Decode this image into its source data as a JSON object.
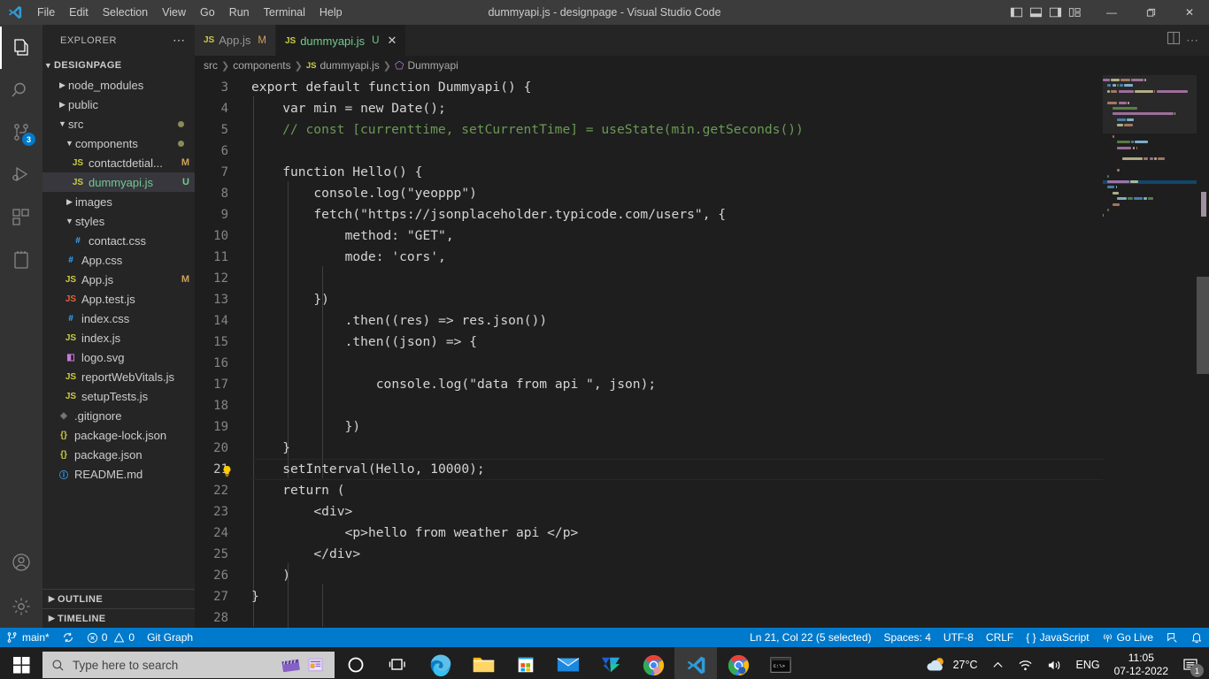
{
  "titlebar": {
    "logo_icon": "vscode-logo-icon",
    "menu": [
      "File",
      "Edit",
      "Selection",
      "View",
      "Go",
      "Run",
      "Terminal",
      "Help"
    ],
    "window_title": "dummyapi.js - designpage - Visual Studio Code",
    "layout_icons": [
      "toggle-primary-sidebar-icon",
      "toggle-panel-icon",
      "toggle-secondary-sidebar-icon",
      "customize-layout-icon"
    ],
    "controls": {
      "minimize": "—",
      "maximize": "❐",
      "close": "✕"
    }
  },
  "activitybar": {
    "items": [
      {
        "name": "explorer",
        "icon": "files-icon",
        "active": true,
        "badge": ""
      },
      {
        "name": "search",
        "icon": "search-icon",
        "active": false,
        "badge": ""
      },
      {
        "name": "source-control",
        "icon": "source-control-icon",
        "active": false,
        "badge": "3"
      },
      {
        "name": "run-and-debug",
        "icon": "run-debug-icon",
        "active": false,
        "badge": ""
      },
      {
        "name": "extensions",
        "icon": "extensions-icon",
        "active": false,
        "badge": ""
      },
      {
        "name": "todo-notes",
        "icon": "notebook-icon",
        "active": false,
        "badge": ""
      }
    ],
    "bottom": [
      {
        "name": "accounts",
        "icon": "account-icon"
      },
      {
        "name": "manage-settings",
        "icon": "gear-icon"
      }
    ]
  },
  "sidebar": {
    "title": "EXPLORER",
    "more_actions": "⋯",
    "root": {
      "label": "DESIGNPAGE",
      "expanded": true
    },
    "tree": [
      {
        "label": "node_modules",
        "type": "folder",
        "depth": 1,
        "expanded": false,
        "icon": "chevron-right-icon",
        "badge": "",
        "dirty": false
      },
      {
        "label": "public",
        "type": "folder",
        "depth": 1,
        "expanded": false,
        "icon": "chevron-right-icon",
        "badge": "",
        "dirty": false
      },
      {
        "label": "src",
        "type": "folder",
        "depth": 1,
        "expanded": true,
        "icon": "chevron-down-icon",
        "badge": "",
        "dirty": true
      },
      {
        "label": "components",
        "type": "folder",
        "depth": 2,
        "expanded": true,
        "icon": "chevron-down-icon",
        "badge": "",
        "dirty": true
      },
      {
        "label": "contactdetial...",
        "type": "js",
        "depth": 3,
        "badge": "M",
        "badge_color": "#cfa25c",
        "selected": false
      },
      {
        "label": "dummyapi.js",
        "type": "js",
        "depth": 3,
        "badge": "U",
        "badge_color": "#73c991",
        "selected": true,
        "text_color": "#73c991"
      },
      {
        "label": "images",
        "type": "folder",
        "depth": 2,
        "expanded": false,
        "icon": "chevron-right-icon",
        "badge": "",
        "dirty": false
      },
      {
        "label": "styles",
        "type": "folder",
        "depth": 2,
        "expanded": true,
        "icon": "chevron-down-icon",
        "badge": "",
        "dirty": false
      },
      {
        "label": "contact.css",
        "type": "css",
        "depth": 3,
        "badge": "",
        "selected": false
      },
      {
        "label": "App.css",
        "type": "css",
        "depth": 2,
        "badge": "",
        "selected": false
      },
      {
        "label": "App.js",
        "type": "js",
        "depth": 2,
        "badge": "M",
        "badge_color": "#cfa25c",
        "selected": false
      },
      {
        "label": "App.test.js",
        "type": "jstest",
        "depth": 2,
        "badge": "",
        "selected": false
      },
      {
        "label": "index.css",
        "type": "css",
        "depth": 2,
        "badge": "",
        "selected": false
      },
      {
        "label": "index.js",
        "type": "js",
        "depth": 2,
        "badge": "",
        "selected": false
      },
      {
        "label": "logo.svg",
        "type": "svg",
        "depth": 2,
        "badge": "",
        "selected": false
      },
      {
        "label": "reportWebVitals.js",
        "type": "js",
        "depth": 2,
        "badge": "",
        "selected": false
      },
      {
        "label": "setupTests.js",
        "type": "js",
        "depth": 2,
        "badge": "",
        "selected": false
      },
      {
        "label": ".gitignore",
        "type": "git",
        "depth": 1,
        "badge": "",
        "selected": false
      },
      {
        "label": "package-lock.json",
        "type": "json",
        "depth": 1,
        "badge": "",
        "selected": false
      },
      {
        "label": "package.json",
        "type": "json",
        "depth": 1,
        "badge": "",
        "selected": false
      },
      {
        "label": "README.md",
        "type": "md",
        "depth": 1,
        "badge": "",
        "selected": false
      }
    ],
    "sections": [
      {
        "label": "OUTLINE",
        "expanded": false,
        "icon": "chevron-right-icon"
      },
      {
        "label": "TIMELINE",
        "expanded": false,
        "icon": "chevron-right-icon"
      }
    ]
  },
  "editor": {
    "tabs": [
      {
        "label": "App.js",
        "icon": "js-file-icon",
        "status": "M",
        "status_type": "modified",
        "active": false,
        "closable": false
      },
      {
        "label": "dummyapi.js",
        "icon": "js-file-icon",
        "status": "U",
        "status_type": "untracked",
        "active": true,
        "closable": true
      }
    ],
    "tab_actions": [
      {
        "name": "split-editor-icon",
        "label": "split-editor"
      },
      {
        "name": "more-actions-icon",
        "label": "⋯"
      }
    ],
    "breadcrumbs": [
      "src",
      "components",
      "dummyapi.js",
      "Dummyapi"
    ],
    "breadcrumb_symbol_icon": "class-symbol-icon",
    "first_visible_line": 3,
    "last_visible_line": 28,
    "current_line": 21,
    "lightbulb_line": 21,
    "lines": [
      {
        "n": 3,
        "text": "export default function Dummyapi() {"
      },
      {
        "n": 4,
        "text": "    var min = new Date();"
      },
      {
        "n": 5,
        "text": "    // const [currenttime, setCurrentTime] = useState(min.getSeconds())"
      },
      {
        "n": 6,
        "text": ""
      },
      {
        "n": 7,
        "text": "    function Hello() {"
      },
      {
        "n": 8,
        "text": "        console.log(\"yeoppp\")"
      },
      {
        "n": 9,
        "text": "        fetch(\"https://jsonplaceholder.typicode.com/users\", {"
      },
      {
        "n": 10,
        "text": "            method: \"GET\","
      },
      {
        "n": 11,
        "text": "            mode: 'cors',"
      },
      {
        "n": 12,
        "text": ""
      },
      {
        "n": 13,
        "text": "        })"
      },
      {
        "n": 14,
        "text": "            .then((res) => res.json())"
      },
      {
        "n": 15,
        "text": "            .then((json) => {"
      },
      {
        "n": 16,
        "text": ""
      },
      {
        "n": 17,
        "text": "                console.log(\"data from api \", json);"
      },
      {
        "n": 18,
        "text": ""
      },
      {
        "n": 19,
        "text": "            })"
      },
      {
        "n": 20,
        "text": "    }"
      },
      {
        "n": 21,
        "text": "    setInterval(Hello, 10000);"
      },
      {
        "n": 22,
        "text": "    return ("
      },
      {
        "n": 23,
        "text": "        <div>"
      },
      {
        "n": 24,
        "text": "            <p>hello from weather api </p>"
      },
      {
        "n": 25,
        "text": "        </div>"
      },
      {
        "n": 26,
        "text": "    )"
      },
      {
        "n": 27,
        "text": "}"
      },
      {
        "n": 28,
        "text": ""
      }
    ],
    "selection_text": "Hello",
    "highlighted_occurrences": [
      "Hello",
      "hello"
    ]
  },
  "statusbar": {
    "left": [
      {
        "name": "remote-branch",
        "icon": "source-control-icon",
        "label": "main*"
      },
      {
        "name": "sync-changes",
        "icon": "sync-icon",
        "label": ""
      },
      {
        "name": "problems",
        "icon": "error-warning-icon",
        "label": "0  0",
        "errors": "0",
        "warnings": "0"
      },
      {
        "name": "git-graph",
        "icon": "",
        "label": "Git Graph"
      }
    ],
    "right": [
      {
        "name": "cursor-position",
        "label": "Ln 21, Col 22 (5 selected)"
      },
      {
        "name": "indentation",
        "label": "Spaces: 4"
      },
      {
        "name": "encoding",
        "label": "UTF-8"
      },
      {
        "name": "eol",
        "label": "CRLF"
      },
      {
        "name": "language-mode",
        "label": "JavaScript",
        "icon": "braces-icon"
      },
      {
        "name": "go-live",
        "label": "Go Live",
        "icon": "broadcast-icon"
      },
      {
        "name": "feedback",
        "label": "",
        "icon": "feedback-icon"
      },
      {
        "name": "notifications",
        "label": "",
        "icon": "bell-icon"
      }
    ],
    "background": "#007acc"
  },
  "taskbar": {
    "start_icon": "windows-start-icon",
    "search": {
      "placeholder": "Type here to search",
      "icon": "search-icon"
    },
    "search_extra_icons": [
      "clapperboard-icon",
      "news-icon"
    ],
    "apps": [
      {
        "name": "cortana-icon",
        "running": false,
        "focused": false
      },
      {
        "name": "task-view-icon",
        "running": false,
        "focused": false
      },
      {
        "name": "microsoft-edge-icon",
        "running": true,
        "focused": false
      },
      {
        "name": "file-explorer-icon",
        "running": true,
        "focused": false
      },
      {
        "name": "microsoft-store-icon",
        "running": false,
        "focused": false
      },
      {
        "name": "mail-icon",
        "running": false,
        "focused": false
      },
      {
        "name": "kite-icon",
        "running": true,
        "focused": false
      },
      {
        "name": "chrome-icon",
        "running": true,
        "focused": false
      },
      {
        "name": "visual-studio-code-icon",
        "running": true,
        "focused": true
      },
      {
        "name": "chrome-secondary-icon",
        "running": true,
        "focused": false
      },
      {
        "name": "command-prompt-icon",
        "running": true,
        "focused": false
      }
    ],
    "tray": {
      "weather": {
        "icon": "partly-cloudy-icon",
        "temperature": "27°C"
      },
      "show_hidden_icon": "chevron-up-icon",
      "network_icon": "wifi-icon",
      "volume_icon": "speaker-icon",
      "language": "ENG",
      "time": "11:05",
      "date": "07-12-2022",
      "notifications": {
        "icon": "notification-icon",
        "count": "1"
      }
    }
  },
  "colors": {
    "accent": "#007acc",
    "titlebar_bg": "#3c3c3c",
    "sidebar_bg": "#252526",
    "editor_bg": "#1e1e1e",
    "activitybar_bg": "#333333",
    "taskbar_bg": "#1f1f1f"
  }
}
